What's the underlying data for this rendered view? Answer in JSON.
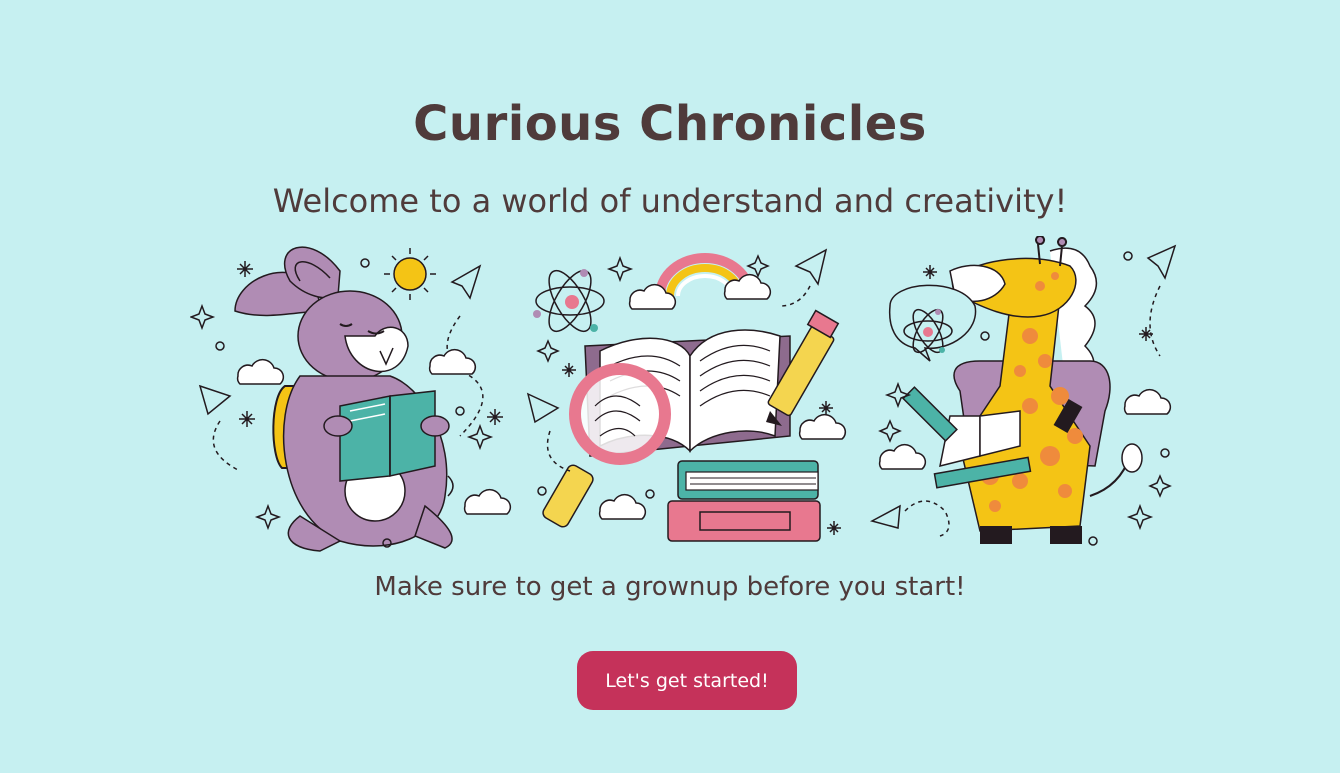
{
  "app": {
    "title": "Curious Chronicles",
    "welcome": "Welcome to a world of understand and creativity!",
    "note": "Make sure to get a grownup before you start!",
    "cta_label": "Let's get started!"
  },
  "illustration": {
    "characters": [
      "rabbit-reading-icon",
      "open-books-icon",
      "giraffe-with-backpack-icon"
    ],
    "decorations": [
      "sun-icon",
      "rainbow-icon",
      "atom-icon",
      "paper-plane-icon",
      "cloud-icon",
      "star-icon",
      "pencil-icon",
      "magnifying-glass-icon"
    ]
  },
  "colors": {
    "background": "#c6f0f1",
    "text": "#4f3b3b",
    "button": "#c5325a",
    "button_text": "#ffffff",
    "rabbit": "#b08cb4",
    "teal": "#4cb3a7",
    "yellow": "#f4c415",
    "pink": "#e8788f",
    "orange": "#ef8b3c"
  }
}
